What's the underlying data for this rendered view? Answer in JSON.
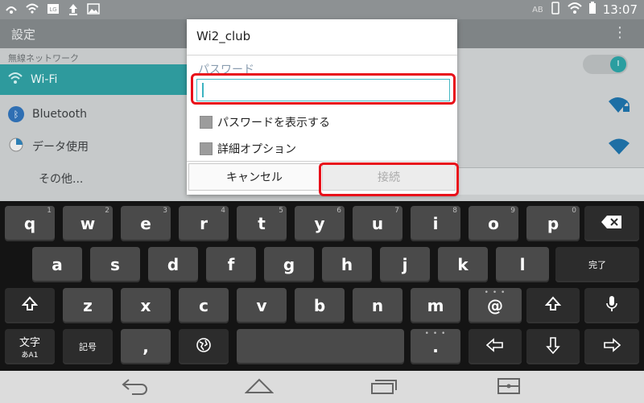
{
  "statusbar": {
    "time": "13:07",
    "ab_label": "AB"
  },
  "settings": {
    "title": "設定",
    "section_wireless": "無線ネットワーク",
    "items": [
      {
        "label": "Wi-Fi",
        "icon": "wifi-icon"
      },
      {
        "label": "Bluetooth",
        "icon": "bluetooth-icon"
      },
      {
        "label": "データ使用",
        "icon": "data-usage-icon"
      },
      {
        "label": "その他..."
      }
    ]
  },
  "dialog": {
    "title": "Wi2_club",
    "password_label": "パスワード",
    "password_value": "",
    "show_password_label": "パスワードを表示する",
    "advanced_label": "詳細オプション",
    "cancel_label": "キャンセル",
    "connect_label": "接続"
  },
  "keyboard": {
    "row1": [
      {
        "k": "q",
        "h": "1"
      },
      {
        "k": "w",
        "h": "2"
      },
      {
        "k": "e",
        "h": "3"
      },
      {
        "k": "r",
        "h": "4"
      },
      {
        "k": "t",
        "h": "5"
      },
      {
        "k": "y",
        "h": "6"
      },
      {
        "k": "u",
        "h": "7"
      },
      {
        "k": "i",
        "h": "8"
      },
      {
        "k": "o",
        "h": "9"
      },
      {
        "k": "p",
        "h": "0"
      }
    ],
    "row2": [
      "a",
      "s",
      "d",
      "f",
      "g",
      "h",
      "j",
      "k",
      "l"
    ],
    "done_label": "完了",
    "row3": [
      "z",
      "x",
      "c",
      "v",
      "b",
      "n",
      "m"
    ],
    "at_key": "@",
    "mode_top": "文字",
    "mode_bottom": "あA1",
    "symbols_label": "記号",
    "comma": ",",
    "period": ".",
    "dots": "• • •"
  },
  "colors": {
    "accent": "#2e9a9d",
    "highlight_red": "#e8101a"
  }
}
